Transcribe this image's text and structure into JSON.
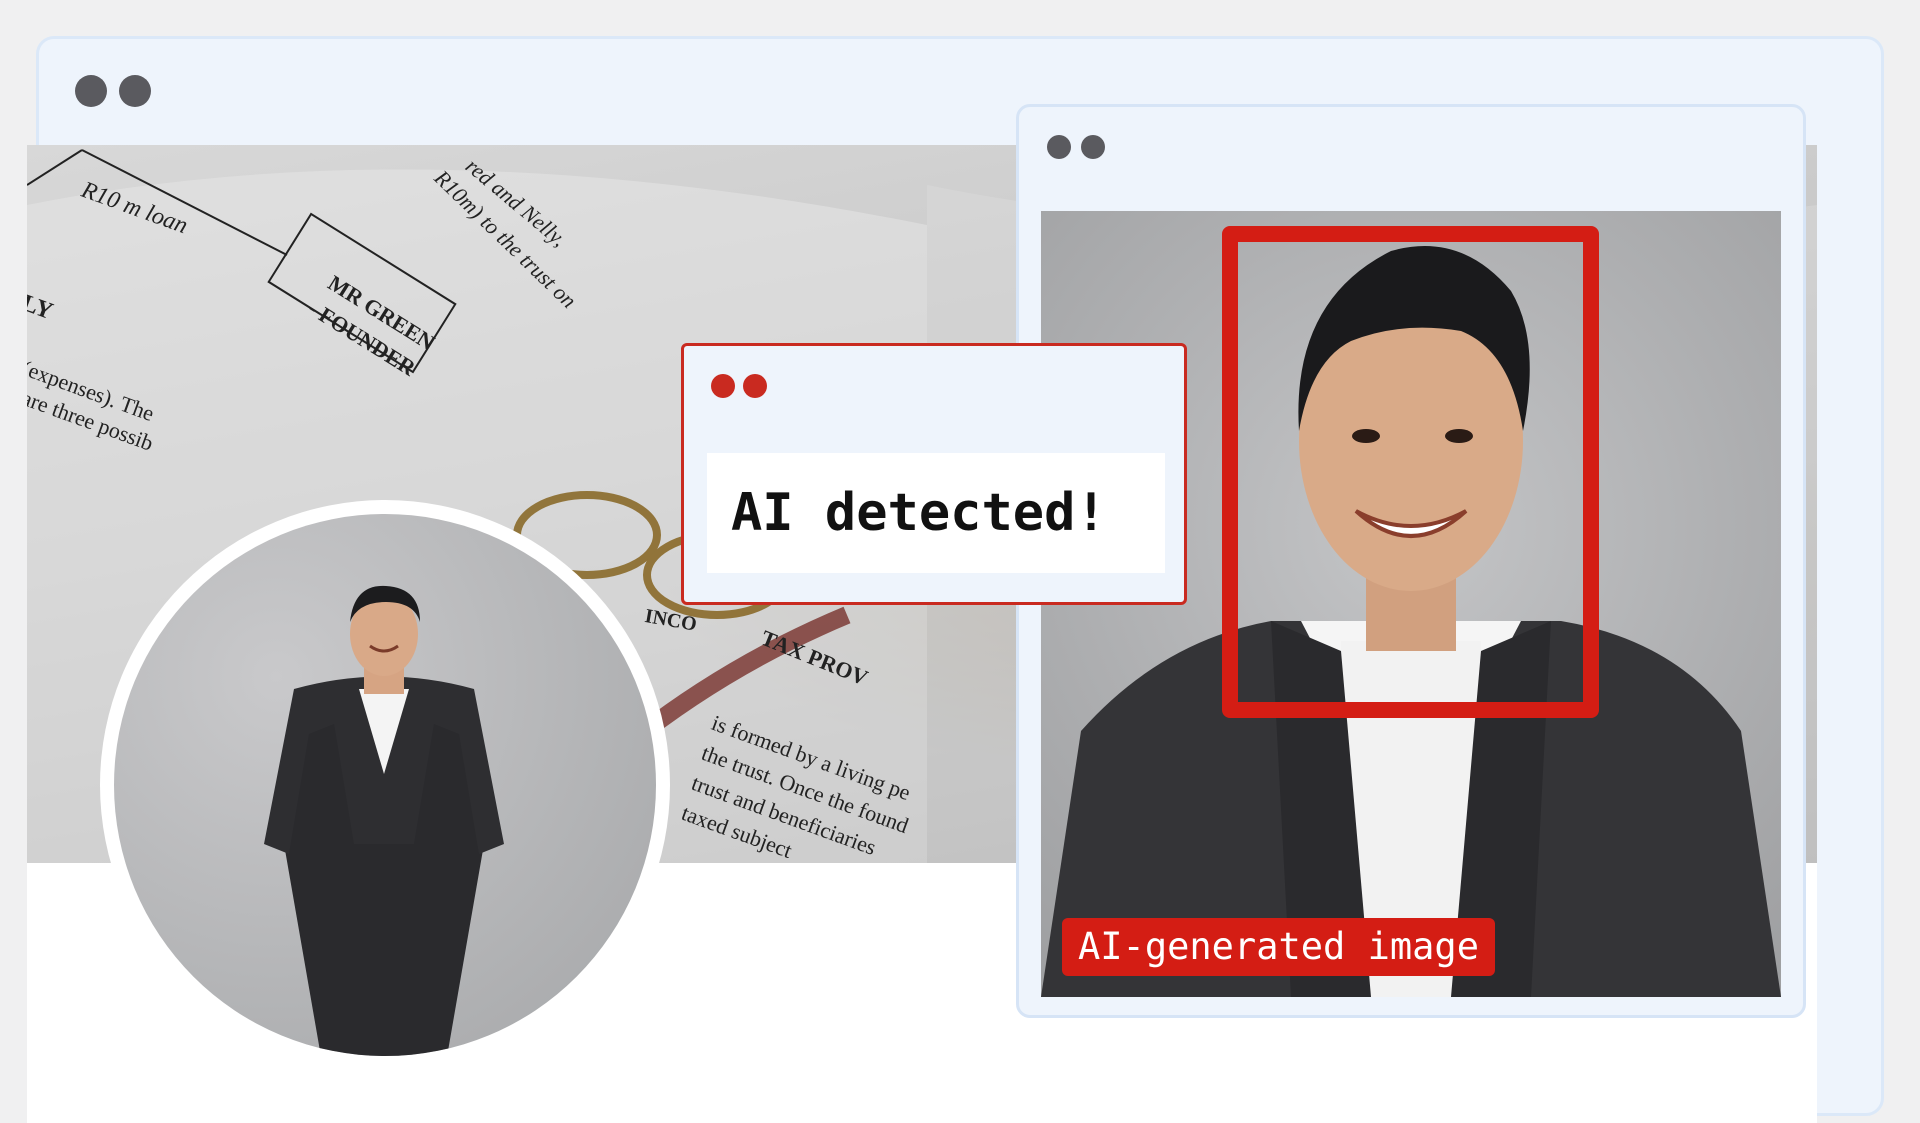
{
  "colors": {
    "window_bg": "#eef4fc",
    "window_border": "#dbe8f8",
    "dot_gray": "#5a5a5f",
    "alert_red": "#d41d14",
    "label_text": "#ffffff"
  },
  "main_window": {
    "icons": [
      "window-control-dot",
      "window-control-dot"
    ],
    "cover_text": {
      "loan": "R10 m loan",
      "founder_line1": "MR GREEN",
      "founder_line2": "- FOUNDER",
      "trust_line1": "red and Nelly,",
      "trust_line2": "R10m) to the trust on",
      "expenses": "(expenses). The",
      "three": "are three possib",
      "ly": "LY",
      "income_tax": "INCO",
      "tax_provision": "TAX PROV",
      "formed": "is formed by a living pe",
      "once": "the trust. Once the found",
      "beneficiaries": "trust and beneficiaries",
      "taxed": "taxed subject"
    }
  },
  "detector_window": {
    "icons": [
      "window-control-dot",
      "window-control-dot"
    ],
    "badge_label": "AI-generated image"
  },
  "alert_popup": {
    "icons": [
      "window-control-dot",
      "window-control-dot"
    ],
    "message": "AI detected!"
  }
}
